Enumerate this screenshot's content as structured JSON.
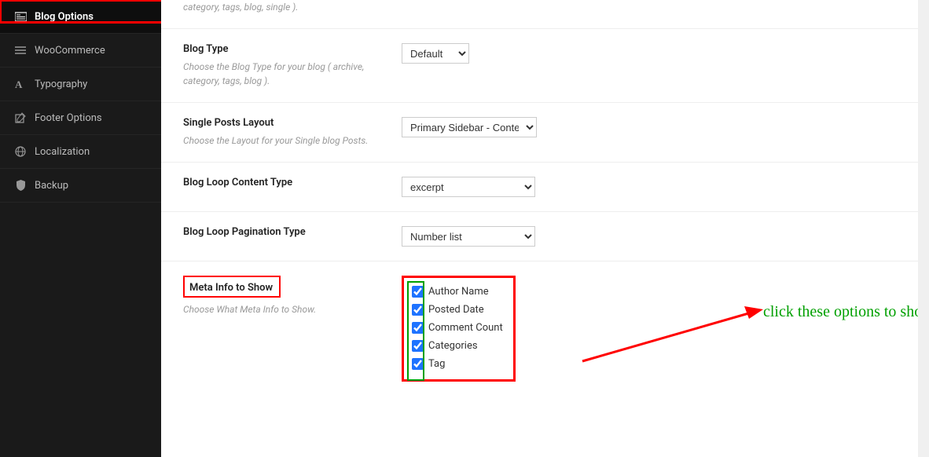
{
  "sidebar": {
    "items": [
      {
        "label": "Blog Options",
        "icon": "news-icon",
        "active": true
      },
      {
        "label": "WooCommerce",
        "icon": "menu-icon"
      },
      {
        "label": "Typography",
        "icon": "font-icon"
      },
      {
        "label": "Footer Options",
        "icon": "edit-icon"
      },
      {
        "label": "Localization",
        "icon": "globe-icon"
      },
      {
        "label": "Backup",
        "icon": "shield-icon"
      }
    ]
  },
  "settings": {
    "top_desc": "category, tags, blog, single ).",
    "blog_type": {
      "label": "Blog Type",
      "desc": "Choose the Blog Type for your blog ( archive, category, tags, blog ).",
      "value": "Default"
    },
    "single_layout": {
      "label": "Single Posts Layout",
      "desc": "Choose the Layout for your Single blog Posts.",
      "value": "Primary Sidebar - Content"
    },
    "loop_content": {
      "label": "Blog Loop Content Type",
      "value": "excerpt"
    },
    "pagination": {
      "label": "Blog Loop Pagination Type",
      "value": "Number list"
    },
    "meta": {
      "label": "Meta Info to Show",
      "desc": "Choose What Meta Info to Show.",
      "options": [
        "Author Name",
        "Posted Date",
        "Comment Count",
        "Categories",
        "Tag"
      ]
    }
  },
  "annotation": "click these options to show the meta"
}
